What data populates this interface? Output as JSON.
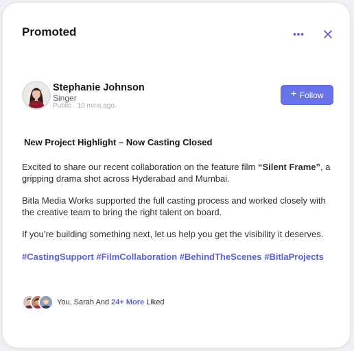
{
  "header": {
    "title": "Promoted",
    "more_icon": "more-horizontal-icon",
    "close_icon": "close-icon",
    "accent": "#5b5fd6"
  },
  "author": {
    "name": "Stephanie Johnson",
    "role": "Singer",
    "meta": "Public . 10 mins ago."
  },
  "follow": {
    "label": "Follow",
    "icon": "plus-icon",
    "color": "#6773e8"
  },
  "post": {
    "headline": "New Project Highlight – Now Casting Closed",
    "p1_before": "Excited to share our recent collaboration on the feature film ",
    "p1_bold": "“Silent Frame”",
    "p1_after": ", a gripping drama shot across Hyderabad and Mumbai.",
    "p2": "Bitla Media Works supported the full casting process and worked closely with the creative team to bring the right talent on board.",
    "p3": "If you’re building something next, let us help you get the visibility it deserves.",
    "tags": [
      "#CastingSupport",
      "#FilmCollaboration",
      "#BehindTheScenes",
      "#BitlaProjects"
    ]
  },
  "likes": {
    "prefix": "You, Sarah And ",
    "more": "24+ More",
    "suffix": " Liked"
  }
}
